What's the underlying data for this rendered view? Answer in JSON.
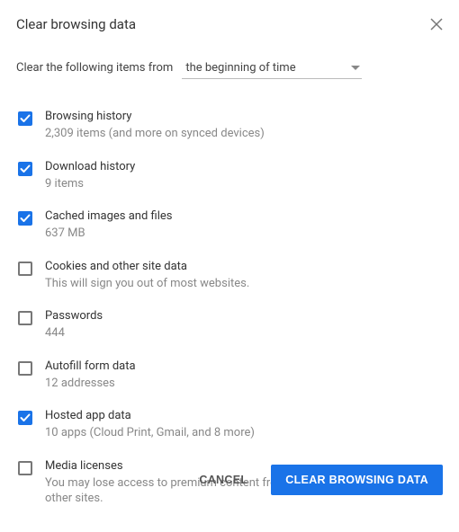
{
  "title": "Clear browsing data",
  "prompt": "Clear the following items from",
  "time_range": {
    "selected": "the beginning of time"
  },
  "options": [
    {
      "label": "Browsing history",
      "sub": "2,309 items (and more on synced devices)",
      "checked": true
    },
    {
      "label": "Download history",
      "sub": "9 items",
      "checked": true
    },
    {
      "label": "Cached images and files",
      "sub": "637 MB",
      "checked": true
    },
    {
      "label": "Cookies and other site data",
      "sub": "This will sign you out of most websites.",
      "checked": false
    },
    {
      "label": "Passwords",
      "sub": "444",
      "checked": false
    },
    {
      "label": "Autofill form data",
      "sub": "12 addresses",
      "checked": false
    },
    {
      "label": "Hosted app data",
      "sub": "10 apps (Cloud Print, Gmail, and 8 more)",
      "checked": true
    },
    {
      "label": "Media licenses",
      "sub": "You may lose access to premium content from www.netflix.com and some other sites.",
      "checked": false
    }
  ],
  "buttons": {
    "cancel": "CANCEL",
    "clear": "CLEAR BROWSING DATA"
  },
  "colors": {
    "primary": "#1a73e8"
  }
}
